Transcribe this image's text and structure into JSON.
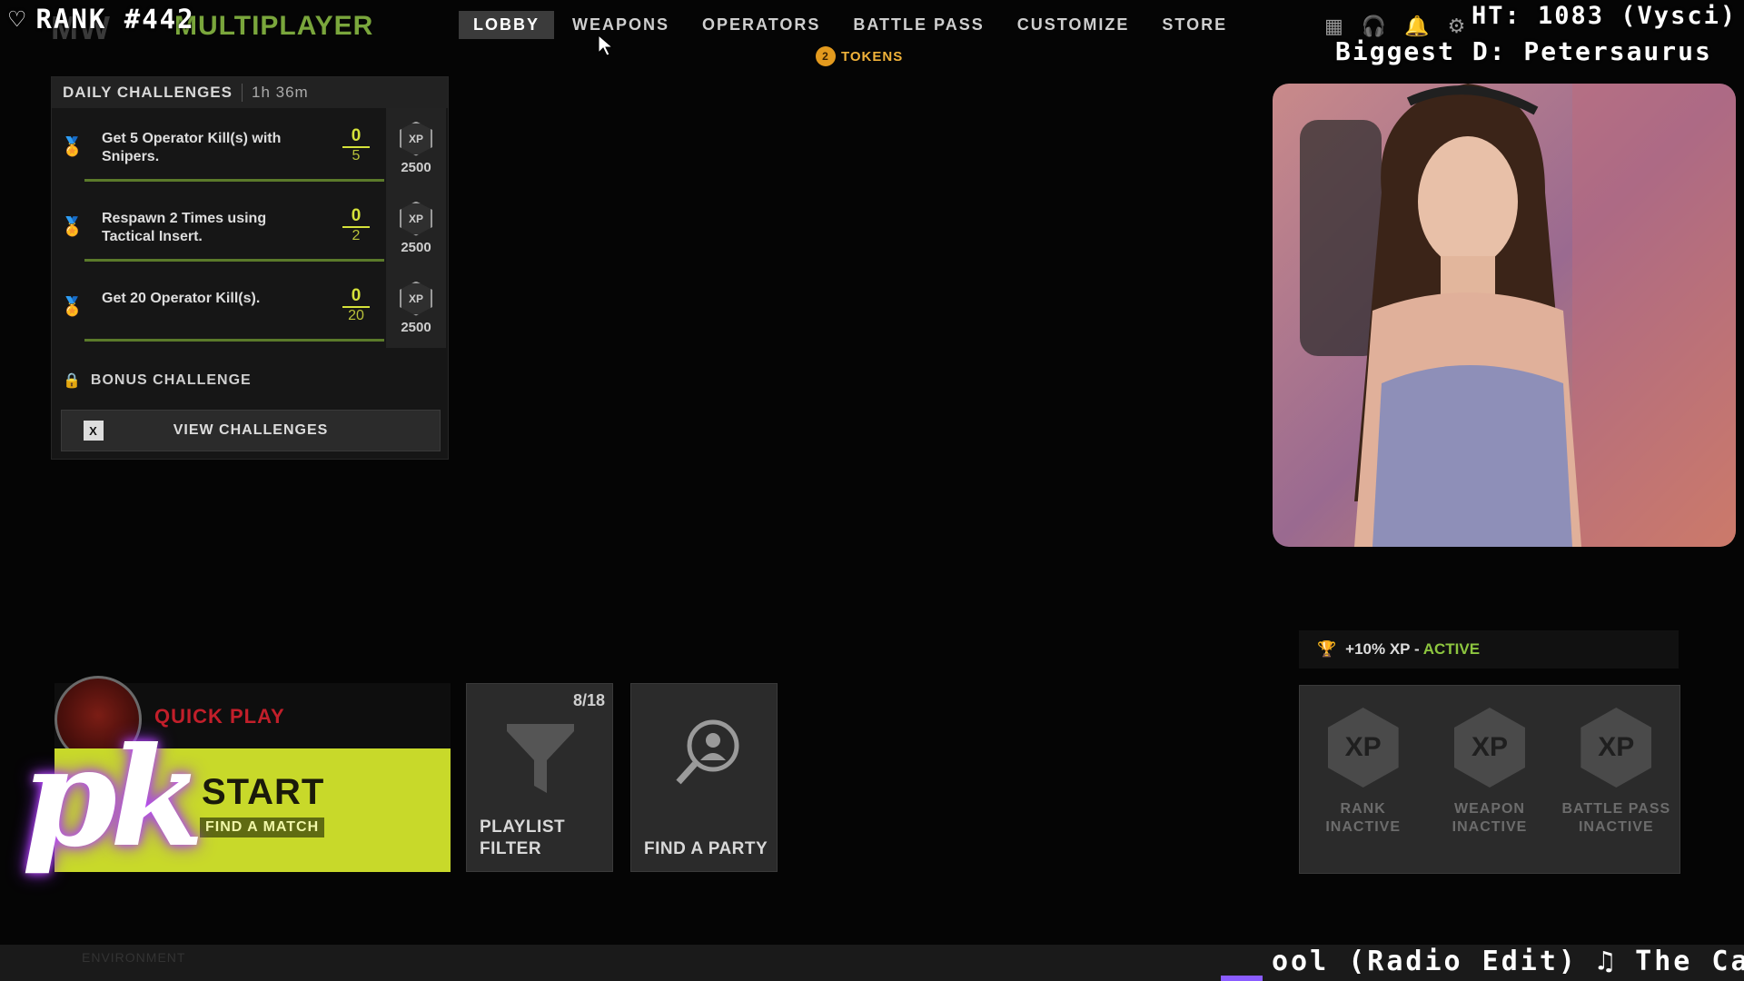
{
  "overlay": {
    "rank": "RANK #442",
    "ht": "HT: 1083 (Vysci)",
    "biggest": "Biggest D: Petersaurus",
    "ticker": "ool (Radio Edit) ♫ The Ca",
    "logo_text": "pk",
    "faint_label": "ENVIRONMENT"
  },
  "header": {
    "game_logo": "MW",
    "mode": "MULTIPLAYER",
    "tabs": [
      "LOBBY",
      "WEAPONS",
      "OPERATORS",
      "BATTLE PASS",
      "CUSTOMIZE",
      "STORE"
    ],
    "active_tab": "LOBBY",
    "tokens_count": "2",
    "tokens_label": "TOKENS"
  },
  "challenges": {
    "title": "DAILY CHALLENGES",
    "timer": "1h 36m",
    "items": [
      {
        "text": "Get 5 Operator Kill(s) with Snipers.",
        "current": "0",
        "max": "5",
        "progress": 0,
        "xp": "2500"
      },
      {
        "text": "Respawn 2 Times using Tactical Insert.",
        "current": "0",
        "max": "2",
        "progress": 0,
        "xp": "2500"
      },
      {
        "text": "Get 20 Operator Kill(s).",
        "current": "0",
        "max": "20",
        "progress": 0,
        "xp": "2500"
      }
    ],
    "xp_icon_text": "XP",
    "bonus_label": "BONUS CHALLENGE",
    "view_key": "X",
    "view_label": "VIEW CHALLENGES"
  },
  "play": {
    "quick_play": "QUICK PLAY",
    "start": "START",
    "start_sub": "FIND A MATCH",
    "playlist_count": "8/18",
    "playlist_label": "PLAYLIST FILTER",
    "party_label": "FIND A PARTY"
  },
  "boosts": {
    "status_prefix": "+10% XP - ",
    "status_active": "ACTIVE",
    "items": [
      {
        "icon": "XP",
        "label": "RANK\nINACTIVE"
      },
      {
        "icon": "XP",
        "label": "WEAPON\nINACTIVE"
      },
      {
        "icon": "XP",
        "label": "BATTLE PASS\nINACTIVE"
      }
    ]
  },
  "colors": {
    "accent_green": "#c8d92a",
    "progress_yellow": "#d5e23a",
    "token_orange": "#e39a1e",
    "quick_play_red": "#c21f2a"
  }
}
